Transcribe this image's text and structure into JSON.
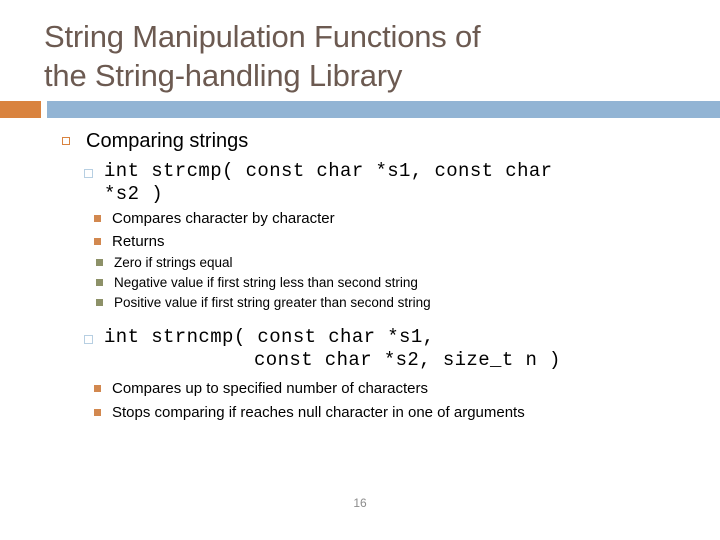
{
  "slide": {
    "title": "String Manipulation Functions of\nthe String-handling Library",
    "title_color": "#6c5a51",
    "accent_orange": "#d9833f",
    "accent_blue": "#92b4d4",
    "accent_olive": "#8d9168",
    "number": "16"
  },
  "content": {
    "section_heading": "Comparing strings",
    "strcmp": {
      "signature_line1": "int strcmp( const char *s1, const char",
      "signature_line2": "*s2 )",
      "notes": [
        "Compares character by character",
        "Returns"
      ],
      "returns": [
        "Zero if strings equal",
        "Negative value if first string less than second string",
        "Positive value if first string greater than second string"
      ]
    },
    "strncmp": {
      "signature_line1": "int strncmp( const char *s1,",
      "signature_line2": "const char *s2, size_t n )",
      "notes": [
        "Compares up to specified number of characters",
        "Stops comparing if reaches null character in one of arguments"
      ]
    }
  }
}
